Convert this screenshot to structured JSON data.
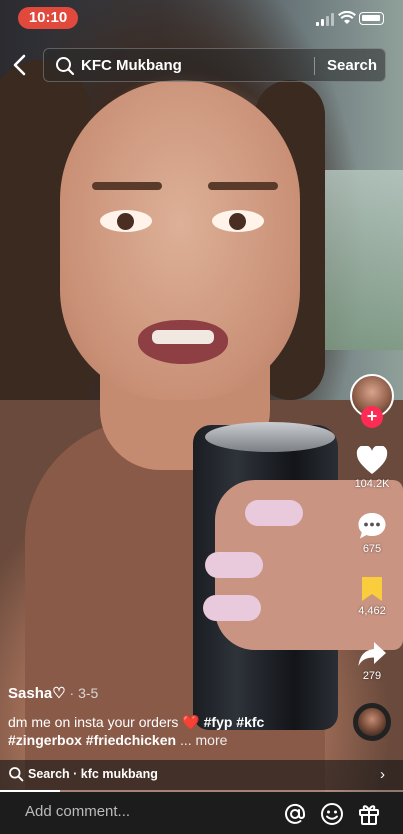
{
  "status_bar": {
    "time": "10:10"
  },
  "search": {
    "query": "KFC Mukbang",
    "button_label": "Search"
  },
  "video": {
    "progress": 0.15
  },
  "actions": {
    "likes": "104.2K",
    "comments": "675",
    "saves": "4,462",
    "shares": "279",
    "like_color": "#ffffff",
    "save_color": "#facd3c",
    "follow_color": "#fe2c55"
  },
  "caption": {
    "author": "Sasha♡",
    "date": " · 3-5",
    "text": "dm me on insta your orders ",
    "emoji": "❤️",
    "hashtags_line1": " #fyp #kfc",
    "hashtags_line2": "#zingerbox #friedchicken",
    "more": " ... more"
  },
  "related_search": {
    "label": "Search · kfc mukbang"
  },
  "bottom_bar": {
    "comment_placeholder": "Add comment..."
  }
}
